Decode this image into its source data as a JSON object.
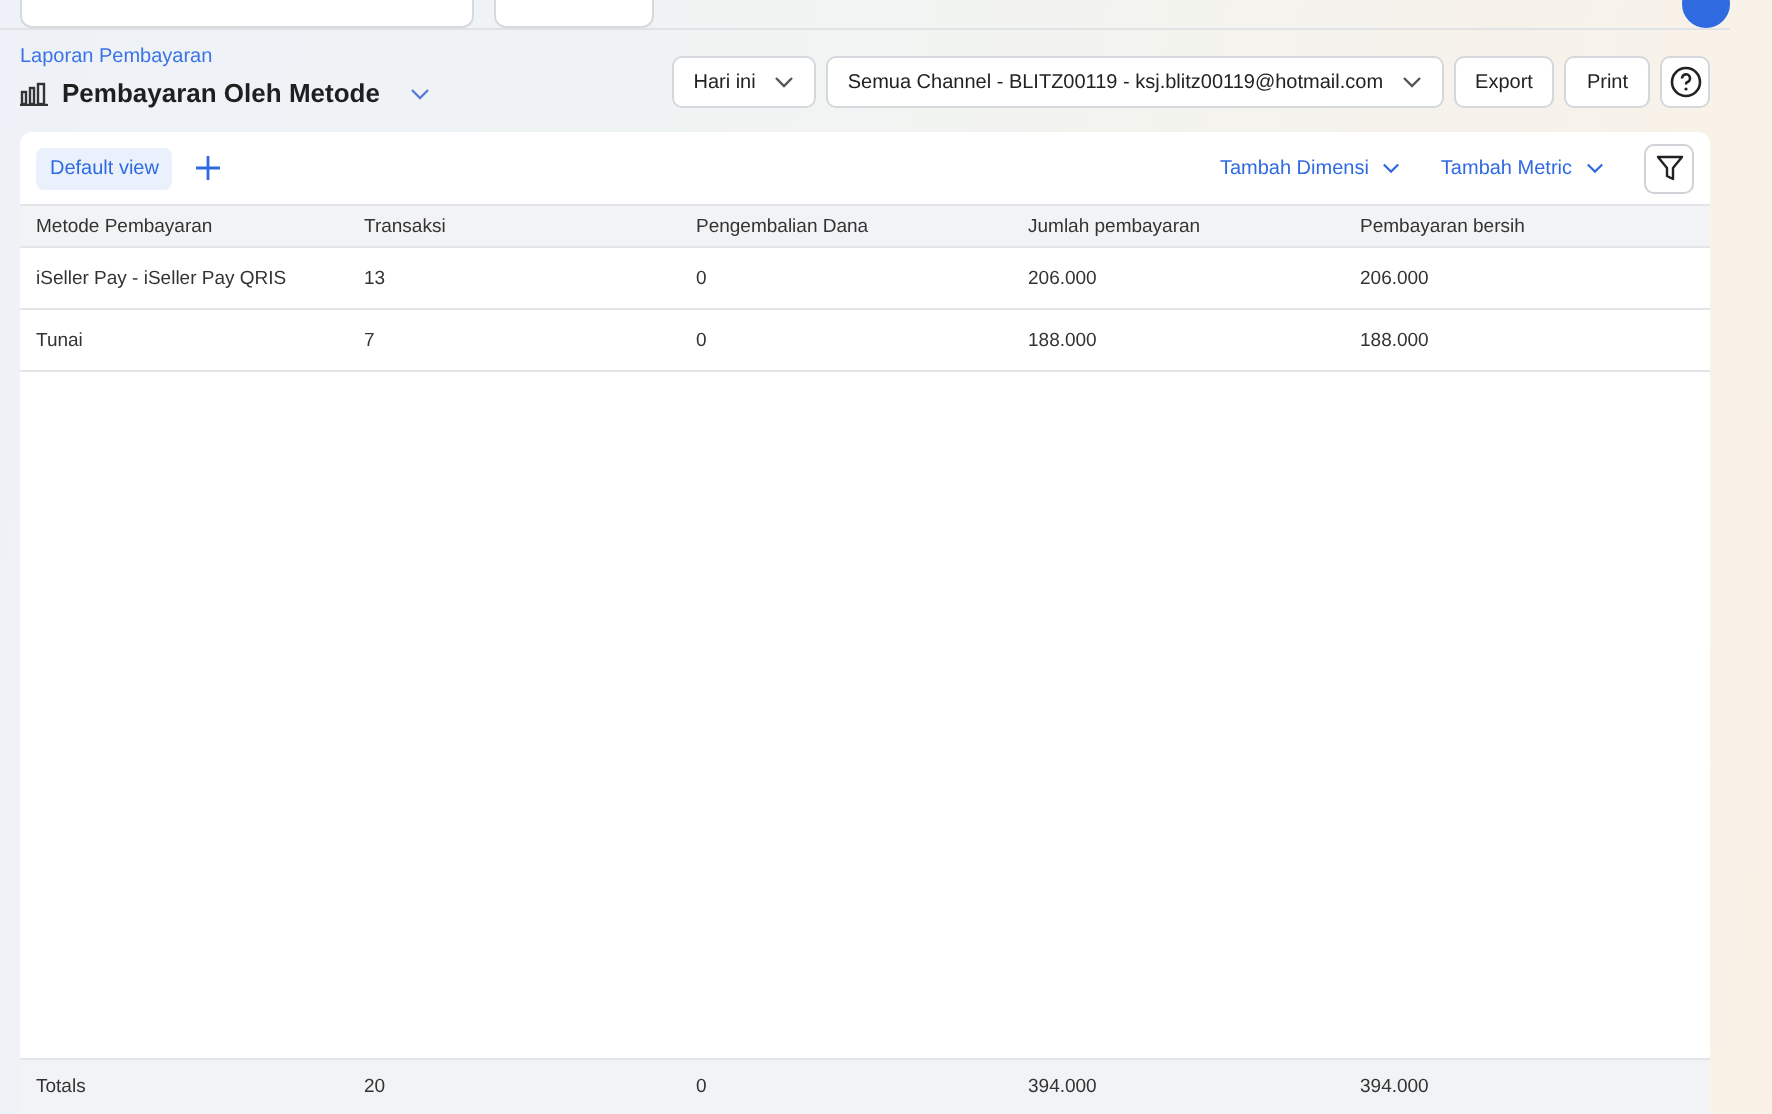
{
  "breadcrumb": "Laporan Pembayaran",
  "title": "Pembayaran Oleh Metode",
  "toolbar": {
    "date_filter": "Hari ini",
    "channel_filter": "Semua Channel - BLITZ00119 - ksj.blitz00119@hotmail.com",
    "buttons": [
      "Export",
      "Print"
    ]
  },
  "views": [
    {
      "label": "Default view",
      "selected": true
    }
  ],
  "actions": [
    "Tambah Dimensi",
    "Tambah Metric"
  ],
  "table": {
    "columns": [
      "Metode Pembayaran",
      "Transaksi",
      "Pengembalian Dana",
      "Jumlah pembayaran",
      "Pembayaran bersih"
    ],
    "rows": [
      [
        "iSeller Pay - iSeller Pay QRIS",
        "13",
        "0",
        "206.000",
        "206.000"
      ],
      [
        "Tunai",
        "7",
        "0",
        "188.000",
        "188.000"
      ]
    ],
    "totals": [
      "Totals",
      "20",
      "0",
      "394.000",
      "394.000"
    ]
  }
}
